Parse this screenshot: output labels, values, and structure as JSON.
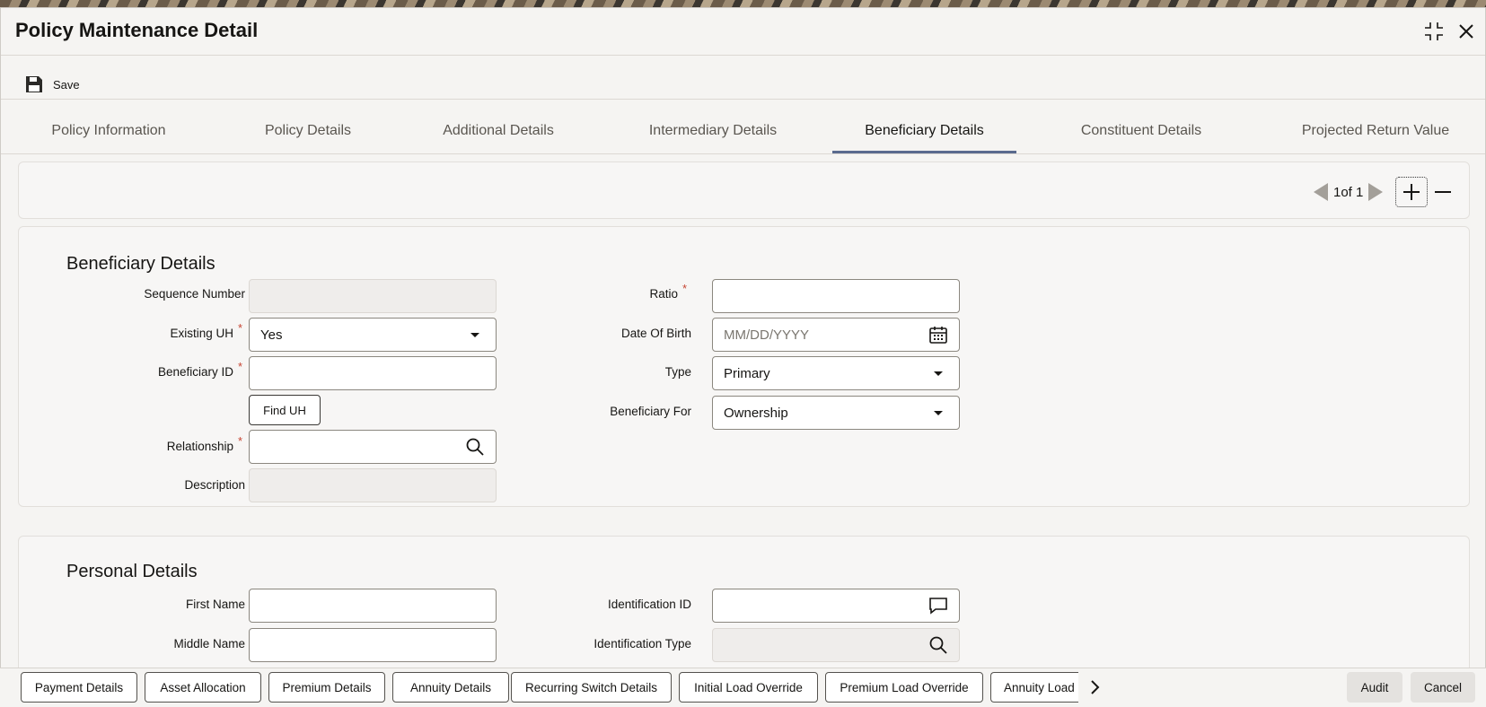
{
  "window": {
    "title": "Policy Maintenance Detail"
  },
  "toolbar": {
    "save_label": "Save"
  },
  "tabs": [
    {
      "label": "Policy Information",
      "active": false
    },
    {
      "label": "Policy Details",
      "active": false
    },
    {
      "label": "Additional Details",
      "active": false
    },
    {
      "label": "Intermediary Details",
      "active": false
    },
    {
      "label": "Beneficiary Details",
      "active": true
    },
    {
      "label": "Constituent Details",
      "active": false
    },
    {
      "label": "Projected Return Value",
      "active": false
    }
  ],
  "pager": {
    "text": "1of 1"
  },
  "beneficiary": {
    "title": "Beneficiary Details",
    "sequence_number_label": "Sequence Number",
    "existing_uh_label": "Existing UH",
    "existing_uh_value": "Yes",
    "beneficiary_id_label": "Beneficiary ID",
    "find_uh_label": "Find UH",
    "relationship_label": "Relationship",
    "description_label": "Description",
    "ratio_label": "Ratio",
    "dob_label": "Date Of Birth",
    "dob_placeholder": "MM/DD/YYYY",
    "type_label": "Type",
    "type_value": "Primary",
    "beneficiary_for_label": "Beneficiary For",
    "beneficiary_for_value": "Ownership"
  },
  "personal": {
    "title": "Personal Details",
    "first_name_label": "First Name",
    "middle_name_label": "Middle Name",
    "identification_id_label": "Identification ID",
    "identification_type_label": "Identification Type"
  },
  "required_mark": "*",
  "bottom_buttons": [
    "Payment Details",
    "Asset Allocation",
    "Premium Details",
    "Annuity Details",
    "Recurring Switch Details",
    "Initial Load Override",
    "Premium Load Override",
    "Annuity Load"
  ],
  "footer": {
    "audit_label": "Audit",
    "cancel_label": "Cancel"
  },
  "colors": {
    "required": "#c74634",
    "active_tab_underline": "#5a6a8e",
    "background": "#f5f4f2"
  }
}
